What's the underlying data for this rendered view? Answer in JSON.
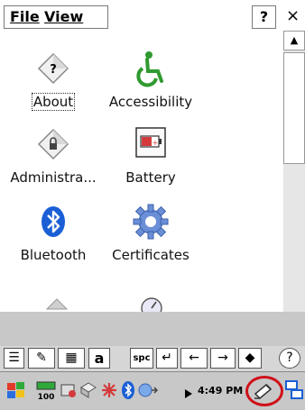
{
  "menubar": {
    "file": "File",
    "view": "View",
    "help": "?",
    "close": "×"
  },
  "items": [
    {
      "label": "About",
      "icon": "help-diamond-icon"
    },
    {
      "label": "Accessibility",
      "icon": "wheelchair-icon"
    },
    {
      "label": "Administra...",
      "icon": "admin-lock-diamond-icon"
    },
    {
      "label": "Battery",
      "icon": "battery-icon"
    },
    {
      "label": "Bluetooth",
      "icon": "bluetooth-icon"
    },
    {
      "label": "Certificates",
      "icon": "certificate-gear-icon"
    }
  ],
  "scrollbar": {
    "up": "▲"
  },
  "sip_keys": [
    "☰",
    "✎",
    "▦",
    "a",
    "spc",
    "↵",
    "←",
    "→",
    "◆",
    "?"
  ],
  "taskbar": {
    "time": "4:49 PM"
  },
  "colors": {
    "highlight_ring": "#d0101a",
    "wheelchair": "#2f9a2f",
    "bluetooth": "#1a5fd6"
  }
}
